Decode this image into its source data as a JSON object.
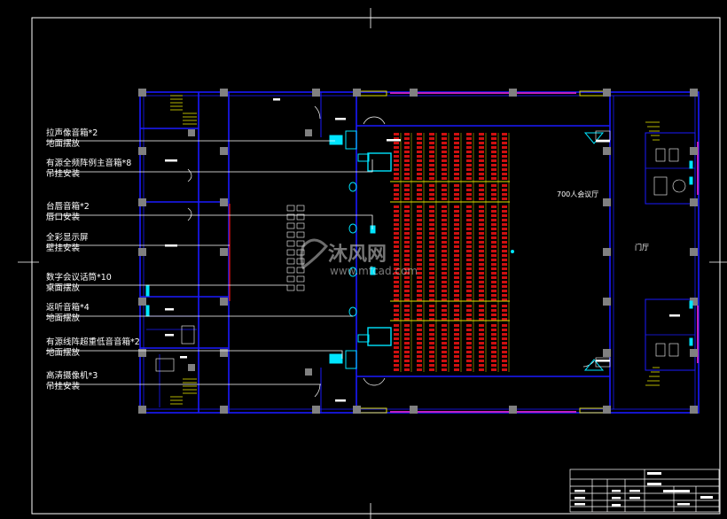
{
  "legend": [
    {
      "title": "拉声像音箱*2",
      "sub": "地面摆放"
    },
    {
      "title": "有源全频阵例主音箱*8",
      "sub": "吊挂安装"
    },
    {
      "title": "台唇音箱*2",
      "sub": "唇口安装"
    },
    {
      "title": "全彩显示屏",
      "sub": "壁挂安装"
    },
    {
      "title": "数字会议话筒*10",
      "sub": "桌面摆放"
    },
    {
      "title": "返听音箱*4",
      "sub": "地面摆放"
    },
    {
      "title": "有源线阵超重低音音箱*2",
      "sub": "地面摆放"
    },
    {
      "title": "高清摄像机*3",
      "sub": "吊挂安装"
    }
  ],
  "hall_label": "700人会议厅",
  "lobby_label": "门厅",
  "watermark": {
    "text": "沐风网",
    "url": "www.mfcad.com"
  },
  "colors": {
    "background": "#000000",
    "wall": "#1a1aff",
    "column": "#808080",
    "seat": "#d01010",
    "aisle": "#e0e000",
    "cyan": "#00e5ff",
    "magenta": "#c020c0",
    "leader": "#ffffff"
  }
}
